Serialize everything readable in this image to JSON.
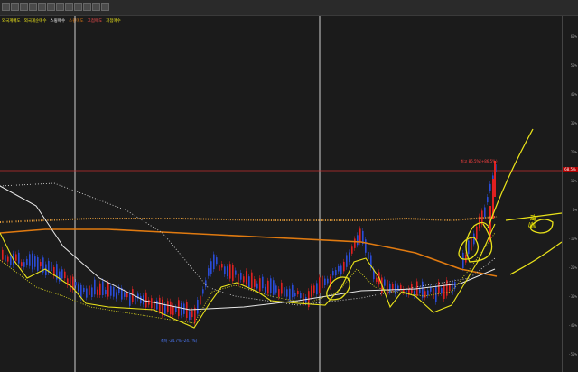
{
  "legend": [
    "외국계매도",
    "외국계순매수",
    "스윙매수",
    "스윙매도",
    "고점매도",
    "저점매수"
  ],
  "price_scale": [
    "60%",
    "50%",
    "40%",
    "30%",
    "20%",
    "10%",
    "0%",
    "-10%",
    "-20%",
    "-30%",
    "-40%",
    "-50%"
  ],
  "current_price_tag": "68.5%",
  "note_high": "최고 86.5%(+86.5%)",
  "note_low": "최저 -24.7%(-24.7%)",
  "handwritten_note": "돌파",
  "colors": {
    "up": "#e02020",
    "down": "#2a4cd8",
    "ma_yellow": "#e9e21a",
    "ma_orange": "#e07a10",
    "ma_white": "#e8e8e8",
    "dotted_orange": "#e39b3a",
    "dotted_white": "#d0d0d0",
    "dotted_yellow": "#d9d41f",
    "bg": "#1b1b1b"
  },
  "toolbar_icons": [
    "grid-icon",
    "line-icon",
    "candle-icon",
    "bar-icon",
    "zoom-in-icon",
    "zoom-out-icon",
    "cursor-icon",
    "crosshair-icon",
    "arrow-left-icon",
    "arrow-right-icon",
    "scroll-icon",
    "settings-icon"
  ]
}
